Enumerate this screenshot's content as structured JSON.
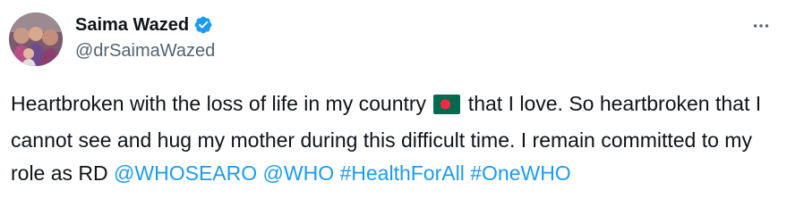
{
  "author": {
    "display_name": "Saima Wazed",
    "handle": "@drSaimaWazed",
    "verified_icon": "verified-badge-icon",
    "avatar_icon": "profile-photo"
  },
  "menu": {
    "more_icon": "more-options-icon"
  },
  "tweet": {
    "text_part1": "Heartbroken with the loss of life in my country ",
    "flag_icon": "bangladesh-flag-icon",
    "text_part2": " that I love. So heartbroken that I cannot see and hug my mother during this difficult time. I remain committed to my role as RD ",
    "mention1": "@WHOSEARO",
    "mention2": "@WHO",
    "hashtag1": "#HealthForAll",
    "hashtag2": "#OneWHO"
  },
  "colors": {
    "link": "#1d9bf0",
    "verified": "#1d9bf0",
    "text": "#0f1419",
    "muted": "#536471"
  }
}
